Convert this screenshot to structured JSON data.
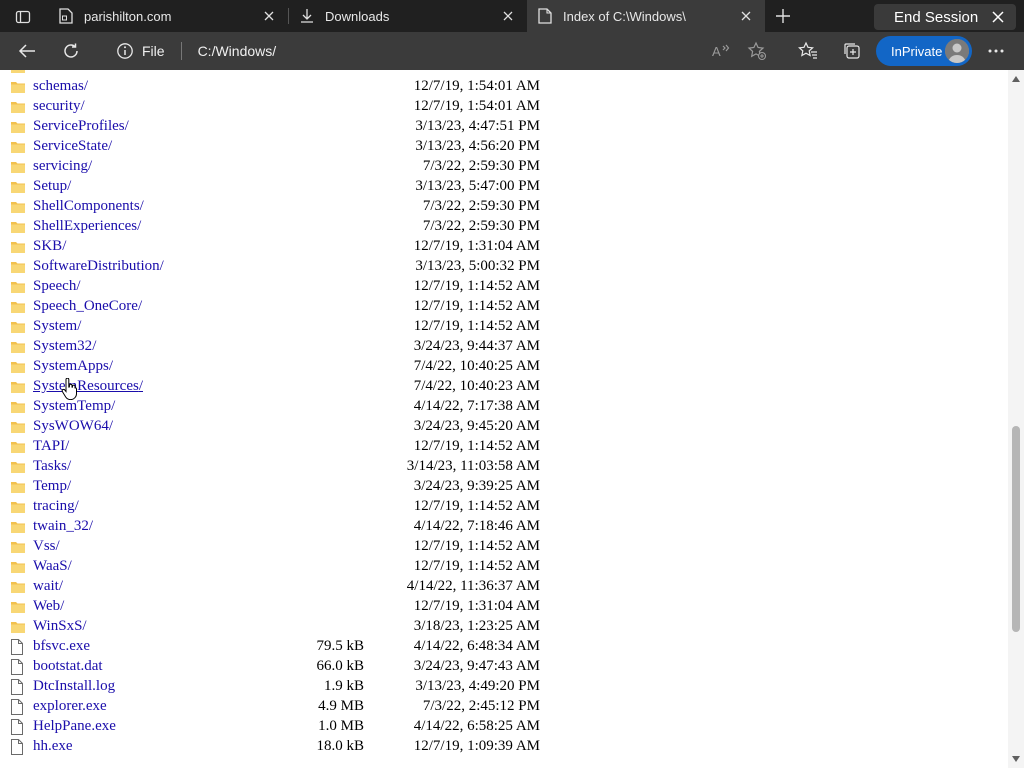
{
  "tabs": [
    {
      "title": "parishilton.com",
      "icon": "page-icon",
      "active": false
    },
    {
      "title": "Downloads",
      "icon": "download-icon",
      "active": false
    },
    {
      "title": "Index of C:\\Windows\\",
      "icon": "page-icon",
      "active": true
    }
  ],
  "end_session_label": "End Session",
  "address": {
    "scheme": "File",
    "path": "C:/Windows/"
  },
  "inprivate_label": "InPrivate",
  "listing": [
    {
      "name": "schemas",
      "slash": "/",
      "size": "",
      "date": "12/7/19, 1:54:01 AM",
      "type": "folder"
    },
    {
      "name": "security",
      "slash": "/",
      "size": "",
      "date": "12/7/19, 1:54:01 AM",
      "type": "folder"
    },
    {
      "name": "ServiceProfiles",
      "slash": "/",
      "size": "",
      "date": "3/13/23, 4:47:51 PM",
      "type": "folder"
    },
    {
      "name": "ServiceState",
      "slash": "/",
      "size": "",
      "date": "3/13/23, 4:56:20 PM",
      "type": "folder"
    },
    {
      "name": "servicing",
      "slash": "/",
      "size": "",
      "date": "7/3/22, 2:59:30 PM",
      "type": "folder"
    },
    {
      "name": "Setup",
      "slash": "/",
      "size": "",
      "date": "3/13/23, 5:47:00 PM",
      "type": "folder"
    },
    {
      "name": "ShellComponents",
      "slash": "/",
      "size": "",
      "date": "7/3/22, 2:59:30 PM",
      "type": "folder"
    },
    {
      "name": "ShellExperiences",
      "slash": "/",
      "size": "",
      "date": "7/3/22, 2:59:30 PM",
      "type": "folder"
    },
    {
      "name": "SKB",
      "slash": "/",
      "size": "",
      "date": "12/7/19, 1:31:04 AM",
      "type": "folder"
    },
    {
      "name": "SoftwareDistribution",
      "slash": "/",
      "size": "",
      "date": "3/13/23, 5:00:32 PM",
      "type": "folder"
    },
    {
      "name": "Speech",
      "slash": "/",
      "size": "",
      "date": "12/7/19, 1:14:52 AM",
      "type": "folder"
    },
    {
      "name": "Speech_OneCore",
      "slash": "/",
      "size": "",
      "date": "12/7/19, 1:14:52 AM",
      "type": "folder"
    },
    {
      "name": "System",
      "slash": "/",
      "size": "",
      "date": "12/7/19, 1:14:52 AM",
      "type": "folder"
    },
    {
      "name": "System32",
      "slash": "/",
      "size": "",
      "date": "3/24/23, 9:44:37 AM",
      "type": "folder"
    },
    {
      "name": "SystemApps",
      "slash": "/",
      "size": "",
      "date": "7/4/22, 10:40:25 AM",
      "type": "folder"
    },
    {
      "name": "SystemResources",
      "slash": "/",
      "size": "",
      "date": "7/4/22, 10:40:23 AM",
      "type": "folder",
      "hover": true
    },
    {
      "name": "SystemTemp",
      "slash": "/",
      "size": "",
      "date": "4/14/22, 7:17:38 AM",
      "type": "folder"
    },
    {
      "name": "SysWOW64",
      "slash": "/",
      "size": "",
      "date": "3/24/23, 9:45:20 AM",
      "type": "folder"
    },
    {
      "name": "TAPI",
      "slash": "/",
      "size": "",
      "date": "12/7/19, 1:14:52 AM",
      "type": "folder"
    },
    {
      "name": "Tasks",
      "slash": "/",
      "size": "",
      "date": "3/14/23, 11:03:58 AM",
      "type": "folder"
    },
    {
      "name": "Temp",
      "slash": "/",
      "size": "",
      "date": "3/24/23, 9:39:25 AM",
      "type": "folder"
    },
    {
      "name": "tracing",
      "slash": "/",
      "size": "",
      "date": "12/7/19, 1:14:52 AM",
      "type": "folder"
    },
    {
      "name": "twain_32",
      "slash": "/",
      "size": "",
      "date": "4/14/22, 7:18:46 AM",
      "type": "folder"
    },
    {
      "name": "Vss",
      "slash": "/",
      "size": "",
      "date": "12/7/19, 1:14:52 AM",
      "type": "folder"
    },
    {
      "name": "WaaS",
      "slash": "/",
      "size": "",
      "date": "12/7/19, 1:14:52 AM",
      "type": "folder"
    },
    {
      "name": "wait",
      "slash": "/",
      "size": "",
      "date": "4/14/22, 11:36:37 AM",
      "type": "folder"
    },
    {
      "name": "Web",
      "slash": "/",
      "size": "",
      "date": "12/7/19, 1:31:04 AM",
      "type": "folder"
    },
    {
      "name": "WinSxS",
      "slash": "/",
      "size": "",
      "date": "3/18/23, 1:23:25 AM",
      "type": "folder"
    },
    {
      "name": "bfsvc.exe",
      "slash": "",
      "size": "79.5 kB",
      "date": "4/14/22, 6:48:34 AM",
      "type": "file"
    },
    {
      "name": "bootstat.dat",
      "slash": "",
      "size": "66.0 kB",
      "date": "3/24/23, 9:47:43 AM",
      "type": "file"
    },
    {
      "name": "DtcInstall.log",
      "slash": "",
      "size": "1.9 kB",
      "date": "3/13/23, 4:49:20 PM",
      "type": "file"
    },
    {
      "name": "explorer.exe",
      "slash": "",
      "size": "4.9 MB",
      "date": "7/3/22, 2:45:12 PM",
      "type": "file"
    },
    {
      "name": "HelpPane.exe",
      "slash": "",
      "size": "1.0 MB",
      "date": "4/14/22, 6:58:25 AM",
      "type": "file"
    },
    {
      "name": "hh.exe",
      "slash": "",
      "size": "18.0 kB",
      "date": "12/7/19, 1:09:39 AM",
      "type": "file"
    }
  ],
  "scroll_position": 0.52
}
